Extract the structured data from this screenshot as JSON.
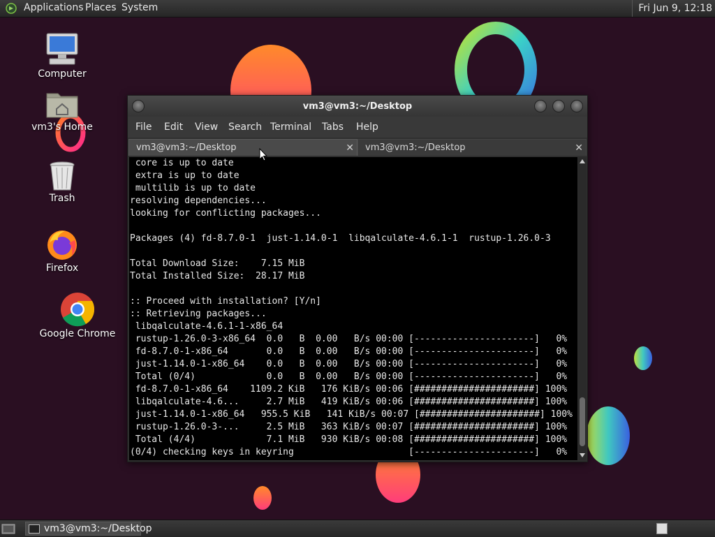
{
  "top_panel": {
    "menus": [
      "Applications",
      "Places",
      "System"
    ],
    "clock": "Fri Jun  9, 12:18"
  },
  "desktop_icons": [
    {
      "label": "Computer",
      "icon": "computer-icon"
    },
    {
      "label": "vm3's Home",
      "icon": "home-folder-icon"
    },
    {
      "label": "Trash",
      "icon": "trash-icon"
    },
    {
      "label": "Firefox",
      "icon": "firefox-icon"
    },
    {
      "label": "Google Chrome",
      "icon": "chrome-icon"
    }
  ],
  "window": {
    "title": "vm3@vm3:~/Desktop",
    "menu": [
      "File",
      "Edit",
      "View",
      "Search",
      "Terminal",
      "Tabs",
      "Help"
    ],
    "tabs": [
      {
        "label": "vm3@vm3:~/Desktop",
        "active": true
      },
      {
        "label": "vm3@vm3:~/Desktop",
        "active": false
      }
    ],
    "terminal_lines": [
      " core is up to date",
      " extra is up to date",
      " multilib is up to date",
      "resolving dependencies...",
      "looking for conflicting packages...",
      "",
      "Packages (4) fd-8.7.0-1  just-1.14.0-1  libqalculate-4.6.1-1  rustup-1.26.0-3",
      "",
      "Total Download Size:    7.15 MiB",
      "Total Installed Size:  28.17 MiB",
      "",
      ":: Proceed with installation? [Y/n]",
      ":: Retrieving packages...",
      " libqalculate-4.6.1-1-x86_64",
      " rustup-1.26.0-3-x86_64  0.0   B  0.00   B/s 00:00 [----------------------]   0%",
      " fd-8.7.0-1-x86_64       0.0   B  0.00   B/s 00:00 [----------------------]   0%",
      " just-1.14.0-1-x86_64    0.0   B  0.00   B/s 00:00 [----------------------]   0%",
      " Total (0/4)             0.0   B  0.00   B/s 00:00 [----------------------]   0%",
      " fd-8.7.0-1-x86_64    1109.2 KiB   176 KiB/s 00:06 [######################] 100%",
      " libqalculate-4.6...     2.7 MiB   419 KiB/s 00:06 [######################] 100%",
      " just-1.14.0-1-x86_64   955.5 KiB   141 KiB/s 00:07 [######################] 100%",
      " rustup-1.26.0-3-...     2.5 MiB   363 KiB/s 00:07 [######################] 100%",
      " Total (4/4)             7.1 MiB   930 KiB/s 00:08 [######################] 100%",
      "(0/4) checking keys in keyring                     [----------------------]   0%"
    ]
  },
  "taskbar": {
    "task_label": "vm3@vm3:~/Desktop"
  }
}
